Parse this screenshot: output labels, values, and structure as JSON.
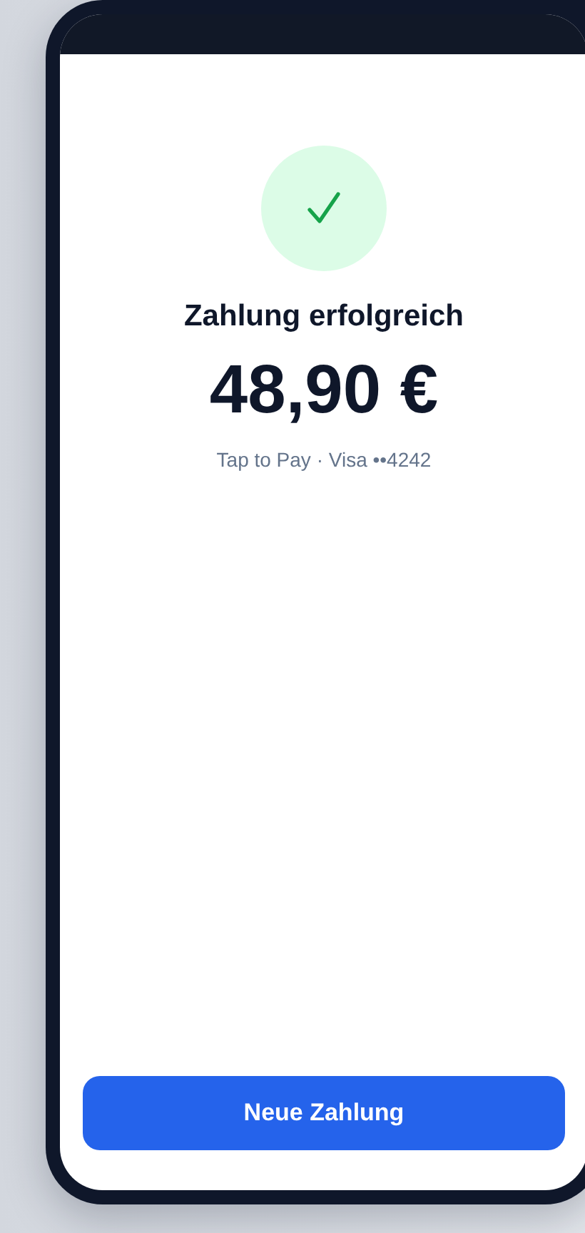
{
  "status": {
    "title": "Zahlung erfolgreich",
    "amount": "48,90 €",
    "details": "Tap to Pay · Visa ••4242"
  },
  "button": {
    "label": "Neue Zahlung"
  }
}
